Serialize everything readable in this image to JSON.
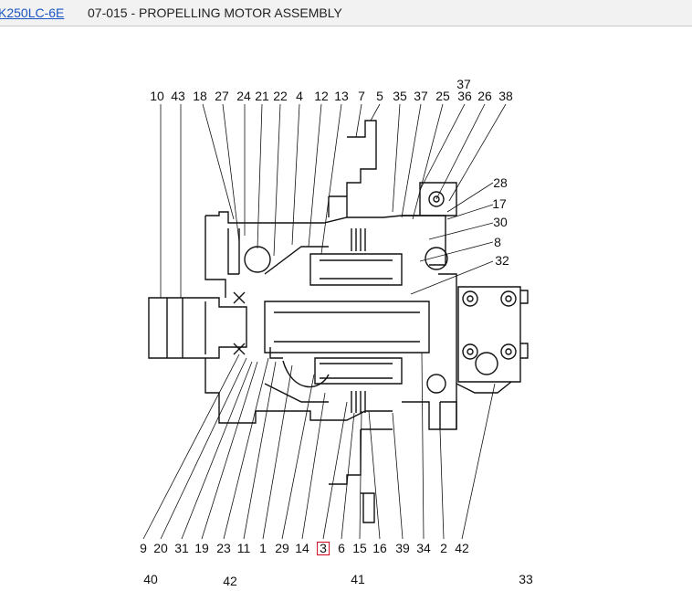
{
  "header": {
    "model_link": "K250LC-6E",
    "title": "07-015 - PROPELLING MOTOR ASSEMBLY"
  },
  "diagram": {
    "highlighted_part": "3",
    "callouts_top": [
      "10",
      "43",
      "18",
      "27",
      "24",
      "21",
      "22",
      "4",
      "12",
      "13",
      "7",
      "5",
      "35",
      "37",
      "25",
      "36",
      "26",
      "38",
      "37"
    ],
    "callouts_right": [
      "28",
      "17",
      "30",
      "8",
      "32"
    ],
    "callouts_bottom": [
      "9",
      "20",
      "31",
      "19",
      "23",
      "11",
      "1",
      "29",
      "14",
      "3",
      "6",
      "15",
      "16",
      "39",
      "34",
      "2",
      "42"
    ],
    "callouts_next_view": [
      "40",
      "42",
      "41",
      "33"
    ]
  },
  "colors": {
    "highlight": "#d0021b",
    "link": "#1a56c4",
    "line": "#111111"
  }
}
